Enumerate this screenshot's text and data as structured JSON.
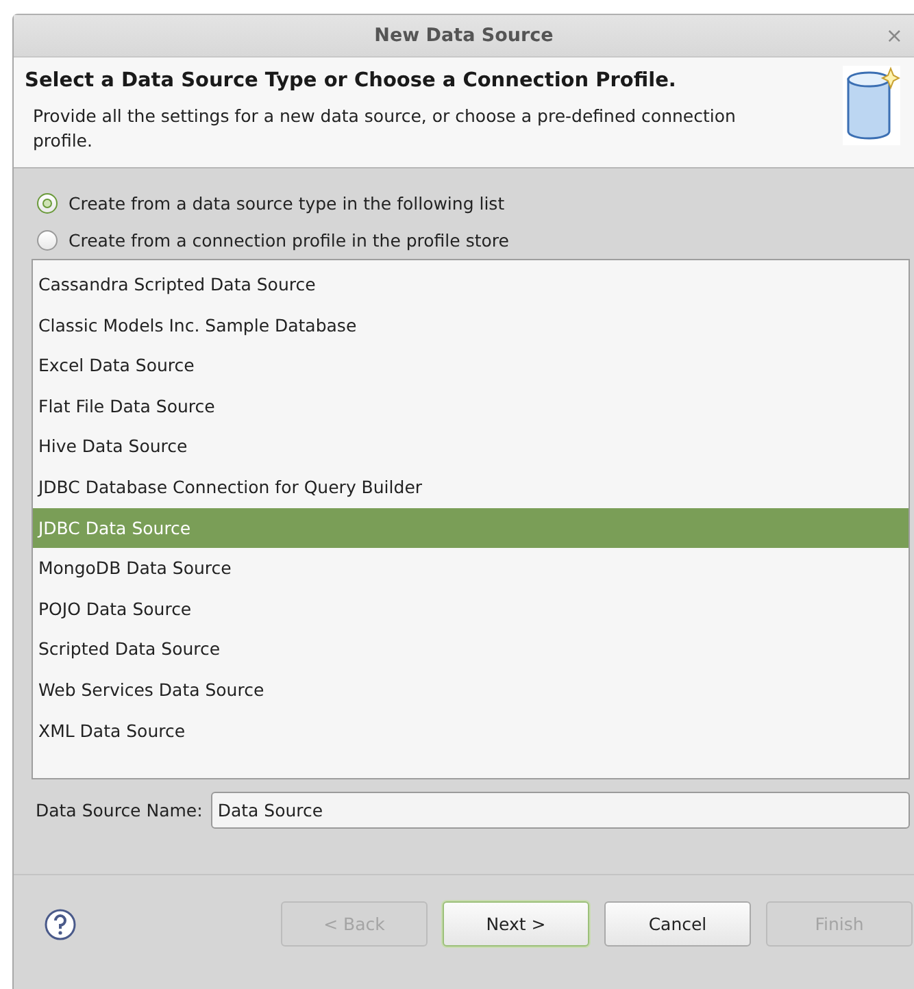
{
  "window": {
    "title": "New Data Source",
    "close": "×"
  },
  "header": {
    "title": "Select a Data Source Type or Choose a Connection Profile.",
    "description": "Provide all the settings for a new data source, or choose a pre-defined connection profile."
  },
  "options": [
    {
      "label": "Create from a data source type in the following list",
      "selected": true
    },
    {
      "label": "Create from a connection profile in the profile store",
      "selected": false
    }
  ],
  "types": [
    {
      "label": "Cassandra Scripted Data Source",
      "selected": false
    },
    {
      "label": "Classic Models Inc. Sample Database",
      "selected": false
    },
    {
      "label": "Excel Data Source",
      "selected": false
    },
    {
      "label": "Flat File Data Source",
      "selected": false
    },
    {
      "label": "Hive Data Source",
      "selected": false
    },
    {
      "label": "JDBC Database Connection for Query Builder",
      "selected": false
    },
    {
      "label": "JDBC Data Source",
      "selected": true
    },
    {
      "label": "MongoDB Data Source",
      "selected": false
    },
    {
      "label": "POJO Data Source",
      "selected": false
    },
    {
      "label": "Scripted Data Source",
      "selected": false
    },
    {
      "label": "Web Services Data Source",
      "selected": false
    },
    {
      "label": "XML Data Source",
      "selected": false
    }
  ],
  "name_field": {
    "label": "Data Source Name:",
    "value": "Data Source"
  },
  "buttons": [
    {
      "label": "< Back",
      "disabled": true,
      "default": false
    },
    {
      "label": "Next >",
      "disabled": false,
      "default": true
    },
    {
      "label": "Cancel",
      "disabled": false,
      "default": false
    },
    {
      "label": "Finish",
      "disabled": true,
      "default": false
    }
  ]
}
